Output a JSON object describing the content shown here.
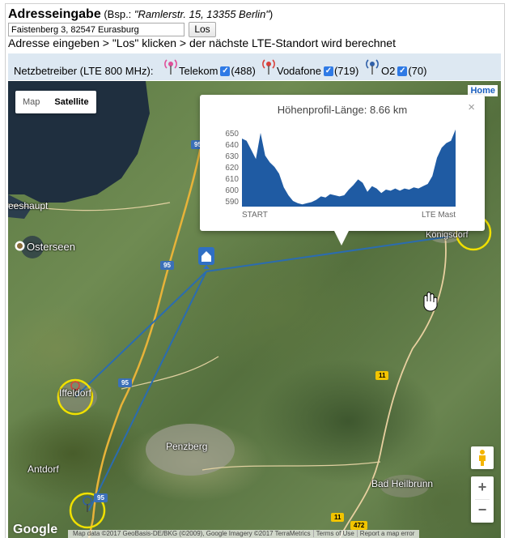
{
  "header": {
    "title": "Adresseingabe",
    "example_prefix": "(Bsp.: ",
    "example": "\"Ramlerstr. 15, 13355 Berlin\"",
    "example_suffix": ")"
  },
  "address_input": {
    "value": "Faistenberg 3, 82547 Eurasburg"
  },
  "submit": {
    "label": "Los"
  },
  "instructions": "Adresse eingeben > \"Los\" klicken > der nächste LTE-Standort wird berechnet",
  "carrier_bar": {
    "label": "Netzbetreiber (LTE 800 MHz):",
    "carriers": [
      {
        "name": "Telekom",
        "count": "(488)",
        "checked": true,
        "color": "#e0509a",
        "icon": "tower-icon"
      },
      {
        "name": "Vodafone",
        "count": "(719)",
        "checked": true,
        "color": "#d9403a",
        "icon": "tower-icon"
      },
      {
        "name": "O2",
        "count": "(70)",
        "checked": true,
        "color": "#2f5fa8",
        "icon": "tower-icon"
      }
    ]
  },
  "map": {
    "type_control": {
      "map": "Map",
      "satellite": "Satellite",
      "selected": "Satellite"
    },
    "home": "Home",
    "places": {
      "seeshaupt": "eeshaupt",
      "osterseen": "Osterseen",
      "iffeldorf": "Iffeldorf",
      "antdorf": "Antdorf",
      "penzberg": "Penzberg",
      "koenigsdorf": "Königsdorf",
      "bad_heilbrunn": "Bad Heilbrunn"
    },
    "road_labels": {
      "a95": "95",
      "b11": "11",
      "b472": "472"
    },
    "zoom": {
      "in": "+",
      "out": "−"
    },
    "google": "Google",
    "attribution": {
      "data": "Map data ©2017 GeoBasis-DE/BKG (©2009), Google Imagery ©2017 TerraMetrics",
      "terms": "Terms of Use",
      "report": "Report a map error"
    },
    "line_color": "#2b6cb0",
    "circle_color": "#f0e000"
  },
  "popup": {
    "close": "×",
    "title": "Höhenprofil-Länge: 8.66 km"
  },
  "chart_data": {
    "type": "area",
    "title": "Höhenprofil-Länge: 8.66 km",
    "x_labels": [
      "START",
      "LTE Mast"
    ],
    "ylim": [
      585,
      655
    ],
    "yticks": [
      590,
      600,
      610,
      620,
      630,
      640,
      650
    ],
    "color": "#1f5ba3",
    "values": [
      645,
      643,
      635,
      627,
      650,
      630,
      624,
      620,
      614,
      602,
      595,
      590,
      588,
      587,
      588,
      589,
      591,
      594,
      593,
      596,
      595,
      594,
      595,
      600,
      604,
      609,
      606,
      598,
      603,
      601,
      597,
      600,
      599,
      601,
      599,
      601,
      600,
      602,
      601,
      603,
      605,
      612,
      628,
      637,
      641,
      643,
      653
    ]
  }
}
